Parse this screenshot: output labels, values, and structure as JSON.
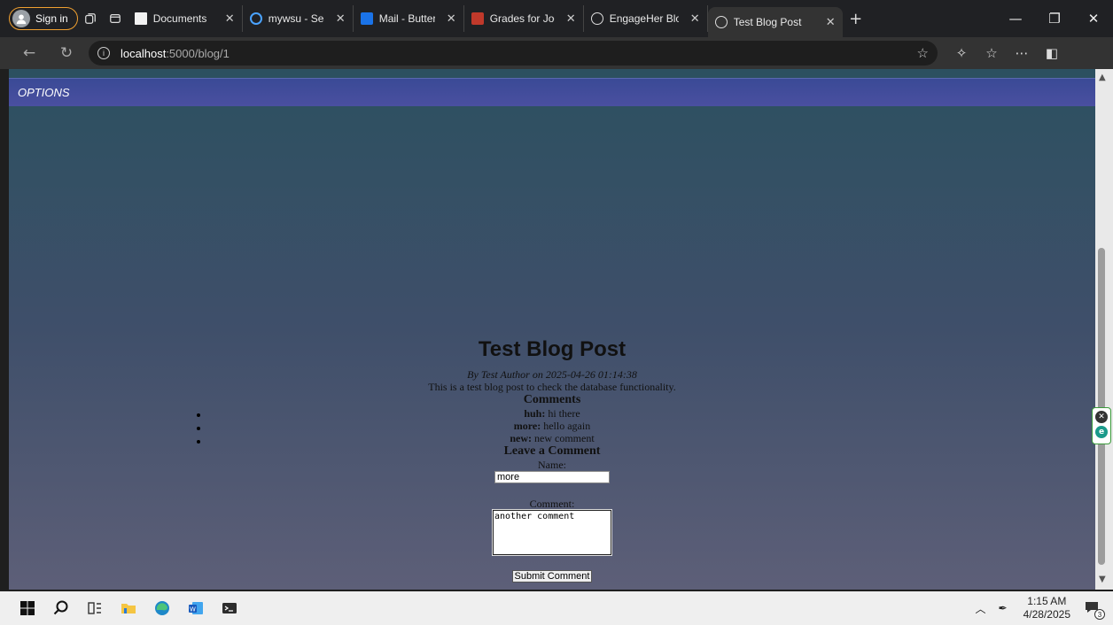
{
  "browser": {
    "signin_label": "Sign in",
    "tabs": [
      {
        "title": "Documents",
        "favicon_color": "#f2f2f2",
        "active": false
      },
      {
        "title": "mywsu - Search",
        "favicon_color": "#4aa3ff",
        "active": false
      },
      {
        "title": "Mail - Butterwor",
        "favicon_color": "#1a73e8",
        "active": false
      },
      {
        "title": "Grades for Jodie",
        "favicon_color": "#c0392b",
        "active": false
      },
      {
        "title": "EngageHer Blog",
        "favicon_color": "#dddddd",
        "active": false
      },
      {
        "title": "Test Blog Post",
        "favicon_color": "#dddddd",
        "active": true
      }
    ],
    "address": {
      "host": "localhost",
      "path": ":5000/blog/1"
    }
  },
  "page": {
    "nav_label": "OPTIONS",
    "title": "Test Blog Post",
    "byline": "By Test Author on 2025-04-26 01:14:38",
    "body": "This is a test blog post to check the database functionality.",
    "comments_heading": "Comments",
    "comments": [
      {
        "author": "huh:",
        "text": "hi there"
      },
      {
        "author": "more:",
        "text": "hello again"
      },
      {
        "author": "new:",
        "text": "new comment"
      }
    ],
    "form": {
      "heading": "Leave a Comment",
      "name_label": "Name:",
      "name_value": "more",
      "comment_label": "Comment:",
      "comment_value": "another comment",
      "submit_label": "Submit Comment"
    }
  },
  "taskbar": {
    "time": "1:15 AM",
    "date": "4/28/2025",
    "notification_count": "3"
  },
  "colors": {
    "nav_bar": "#4a4fa0",
    "page_top": "#2c5060",
    "page_bottom": "#5d5f78",
    "signin_border": "#f0a030"
  }
}
